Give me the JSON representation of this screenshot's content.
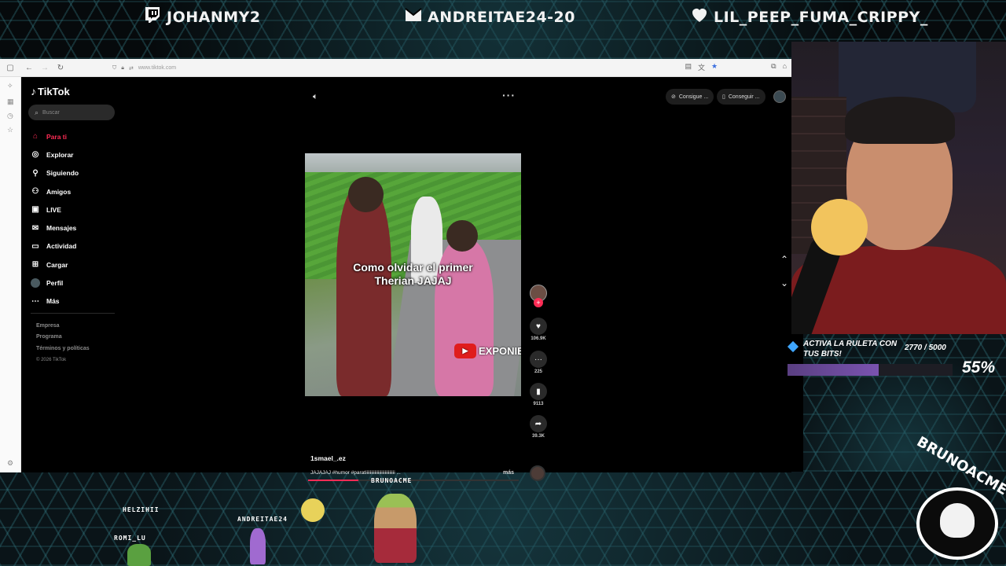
{
  "overlay": {
    "socials": [
      {
        "platform": "twitch-icon",
        "handle": "JOHANMY2"
      },
      {
        "platform": "kick-icon",
        "handle": "ANDREITAE24-20"
      },
      {
        "platform": "heart-icon",
        "handle": "LIL_PEEP_FUMA_CRIPPY_"
      }
    ],
    "bits": {
      "title": "ACTIVA LA RULETA CON TUS BITS!",
      "count": "2770 / 5000",
      "percent_label": "55%",
      "fraction": 0.554
    },
    "chat_viewers": [
      "HELZIHII",
      "ANDREITAE24",
      "BRUNOACME",
      "ROMI_LU"
    ],
    "logo_text": "BRUNOACME"
  },
  "browser": {
    "url": "www.tiktok.com"
  },
  "tiktok": {
    "brand": "TikTok",
    "search_placeholder": "Buscar",
    "nav": [
      {
        "label": "Para ti",
        "icon": "home-icon",
        "active": true
      },
      {
        "label": "Explorar",
        "icon": "compass-icon",
        "active": false
      },
      {
        "label": "Siguiendo",
        "icon": "following-icon",
        "active": false
      },
      {
        "label": "Amigos",
        "icon": "friends-icon",
        "active": false
      },
      {
        "label": "LIVE",
        "icon": "live-icon",
        "active": false
      },
      {
        "label": "Mensajes",
        "icon": "message-icon",
        "active": false
      },
      {
        "label": "Actividad",
        "icon": "activity-icon",
        "active": false
      },
      {
        "label": "Cargar",
        "icon": "upload-icon",
        "active": false
      },
      {
        "label": "Perfil",
        "icon": "profile-icon",
        "active": false
      },
      {
        "label": "Más",
        "icon": "more-icon",
        "active": false
      }
    ],
    "footer": [
      "Empresa",
      "Programa",
      "Términos y políticas"
    ],
    "copyright": "© 2026 TikTok",
    "top_buttons": [
      "Consigue ...",
      "Conseguir ..."
    ],
    "video": {
      "caption_line1": "Como olvidar el primer",
      "caption_line2": "Therian JAJAJ",
      "watermark": "EXPONIE",
      "author": "1smael_.ez",
      "description": "JAJAJAJ #humor #paratiiiiiiiiiiiiiiiiiiiiiiiiii ...",
      "more_label": "más",
      "progress": 0.24
    },
    "actions": {
      "likes": "106.9K",
      "comments": "225",
      "saves": "9113",
      "shares": "39.3K"
    }
  }
}
